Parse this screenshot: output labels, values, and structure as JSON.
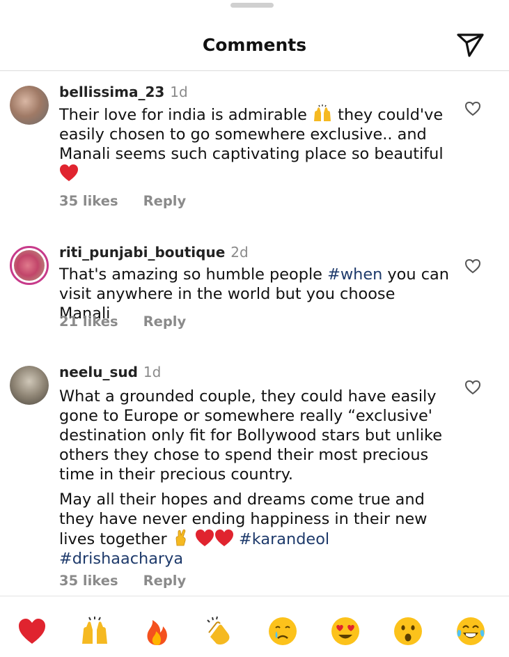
{
  "header": {
    "title": "Comments"
  },
  "comments": [
    {
      "username": "bellissima_23",
      "time": "1d",
      "lines": [
        "Their love for india is admirable 🙌 they could've easily chosen to go somewhere exclusive.. and Manali seems such captivating place so beautiful ❤️"
      ],
      "text_before": "Their love for india is admirable ",
      "text_mid": " they could've easily chosen to go somewhere exclusive.. and Manali seems such captivating place so beautiful",
      "likes": "35 likes",
      "reply": "Reply"
    },
    {
      "username": "riti_punjabi_boutique",
      "time": "2d",
      "text_before": "That's amazing so humble people ",
      "hashtag": "#when",
      "text_after": " you can visit anywhere in the world but you choose Manali",
      "likes": "21 likes",
      "reply": "Reply"
    },
    {
      "username": "neelu_sud",
      "time": "1d",
      "para1": "What a grounded couple, they could have easily gone to Europe or somewhere really “exclusive' destination only fit for Bollywood stars but unlike others they chose to spend their most precious time in their precious country.",
      "para2_text": "May all their hopes and dreams come true and they have never ending happiness in their new lives together ",
      "hashtag1": "#karandeol",
      "hashtag2": "#drishaacharya",
      "likes": "35 likes",
      "reply": "Reply"
    }
  ],
  "reactions": [
    "heart",
    "raising-hands",
    "fire",
    "clapping-hands",
    "crying-face",
    "heart-eyes-face",
    "surprised-face",
    "tears-of-joy-face"
  ],
  "colors": {
    "hashtag": "#1e3a6b",
    "heart": "#e0242f",
    "muted": "#8a8a8a"
  }
}
